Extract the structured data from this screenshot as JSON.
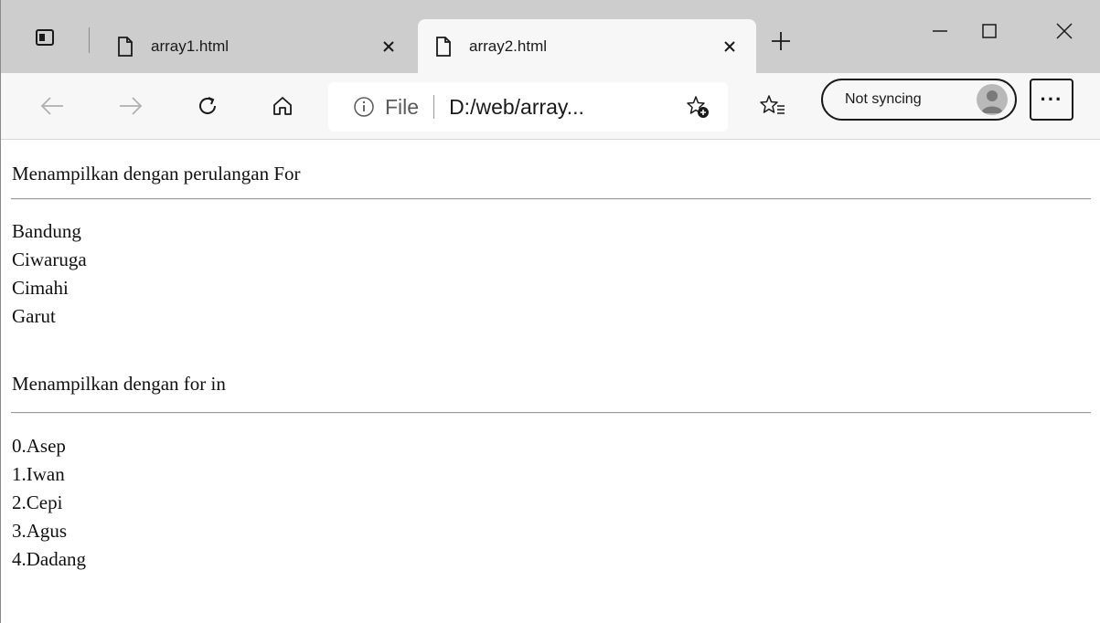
{
  "tabs": [
    {
      "title": "array1.html",
      "active": false
    },
    {
      "title": "array2.html",
      "active": true
    }
  ],
  "icons": {
    "tab_actions": "tab-actions-icon",
    "page": "page-icon",
    "close": "close-icon",
    "new_tab": "plus-icon",
    "back": "back-arrow-icon",
    "forward": "forward-arrow-icon",
    "refresh": "refresh-icon",
    "home": "home-icon",
    "info": "info-icon",
    "add_favorite": "add-favorite-icon",
    "favorites": "favorites-icon",
    "more": "more-icon"
  },
  "address": {
    "scheme_label": "File",
    "url": "D:/web/array..."
  },
  "profile": {
    "sync_label": "Not syncing"
  },
  "more_label": "···",
  "content": {
    "section1_heading": "Menampilkan dengan perulangan For",
    "section1_items": [
      "Bandung",
      "Ciwaruga",
      "Cimahi",
      "Garut"
    ],
    "section2_heading": "Menampilkan dengan for in",
    "section2_items": [
      "0.Asep",
      "1.Iwan",
      "2.Cepi",
      "3.Agus",
      "4.Dadang"
    ]
  },
  "colors": {
    "tabstrip": "#cdcdcd",
    "toolbar": "#f7f7f7",
    "page_bg": "#ffffff"
  }
}
